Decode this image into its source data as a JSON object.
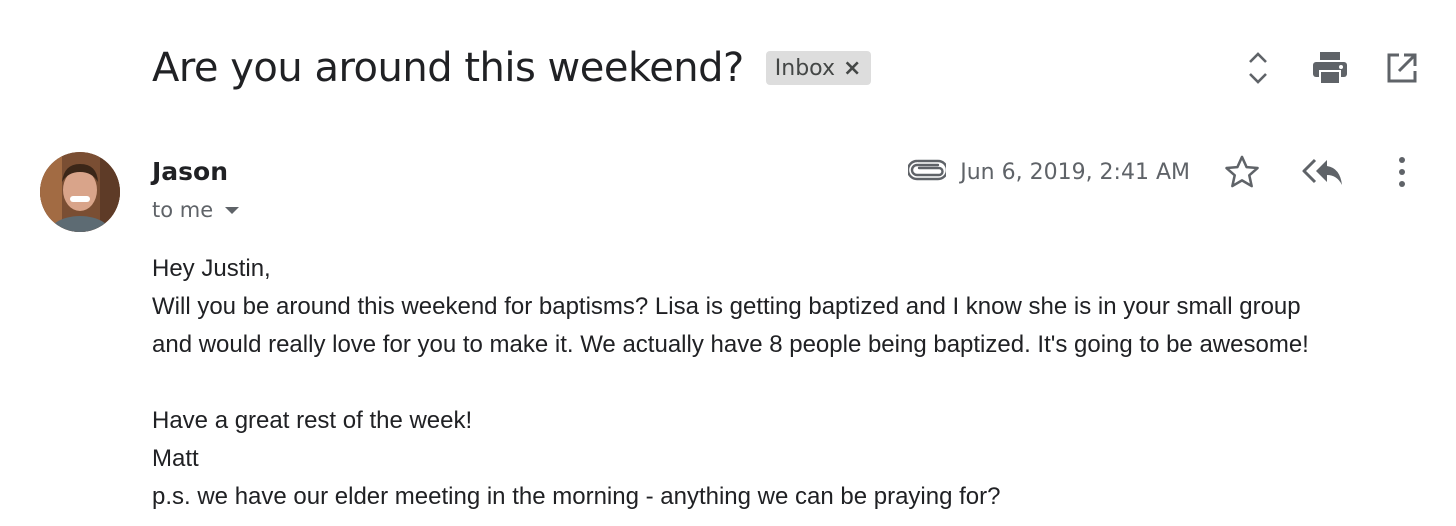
{
  "thread": {
    "subject": "Are you around this weekend?",
    "label": "Inbox",
    "label_remove_glyph": "×",
    "actions": [
      "expand-collapse-icon",
      "print-icon",
      "open-in-new-window-icon"
    ]
  },
  "message": {
    "sender": "Jason",
    "recipient": "to me",
    "date": "Jun 6, 2019, 2:41 AM",
    "has_attachment": true,
    "actions": [
      "star-icon",
      "reply-all-icon",
      "more-vert-icon"
    ],
    "body": {
      "greeting": "Hey Justin,",
      "line1": "Will you be around this weekend for baptisms? Lisa is getting baptized and I know she is in your small group",
      "line2": "and would really love for you to make it. We actually have 8 people being baptized. It's going to be awesome!",
      "closing": "Have a great rest of the week!",
      "signature": "Matt",
      "ps": "p.s. we have our elder meeting in the morning - anything we can be praying for?"
    }
  },
  "colors": {
    "text_primary": "#202124",
    "text_secondary": "#5f6368",
    "chip_bg": "#dddddd"
  }
}
